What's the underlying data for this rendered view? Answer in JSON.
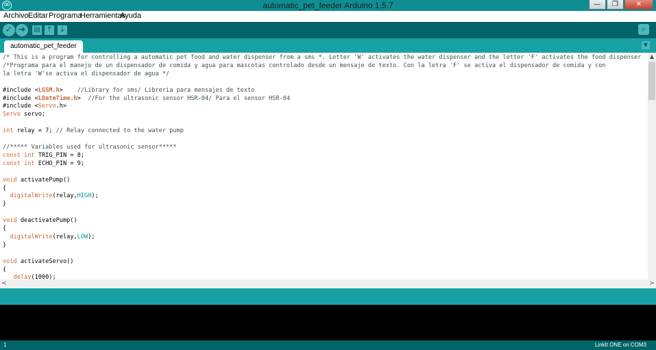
{
  "window": {
    "title": "automatic_pet_feeder Arduino 1.5.7",
    "min_label": "—",
    "max_label": "❐",
    "close_label": "✕"
  },
  "menu": [
    "Archivo",
    "Editar",
    "Programa",
    "Herramientas",
    "Ayuda"
  ],
  "toolbar": {
    "verify_glyph": "✓",
    "upload_glyph": "➜",
    "new_glyph": "▤",
    "open_glyph": "⇡",
    "save_glyph": "⇣",
    "serial_glyph": "⌕"
  },
  "tab": {
    "label": "automatic_pet_feeder",
    "menu_glyph": "▼"
  },
  "code_lines": [
    [
      {
        "t": "/* This is a program for controlling a automatic pet food and water dispenser from a sms *. Letter 'W' activates the water dispenser and the letter 'F' activates the food dispenser",
        "c": "com"
      }
    ],
    [
      {
        "t": "/*Programa para el manejo de un dispensador de comida y agua para mascotas controlado desde un mensaje de texto. Con la letra 'F' se activa el dispensador de comida y con",
        "c": "com"
      }
    ],
    [
      {
        "t": "la letra 'W'se activa el dispensador de agua */",
        "c": "com"
      }
    ],
    [],
    [
      {
        "t": "#include <",
        "c": ""
      },
      {
        "t": "LGSM.h",
        "c": "lib"
      },
      {
        "t": ">    ",
        "c": ""
      },
      {
        "t": "//Library for sms/ Libreria para mensajes de texto",
        "c": "com"
      }
    ],
    [
      {
        "t": "#include <",
        "c": ""
      },
      {
        "t": "LDateTime.h",
        "c": "lib"
      },
      {
        "t": ">  ",
        "c": ""
      },
      {
        "t": "//For the ultrasonic sensor HSR-04/ Para el sensor HSR-04",
        "c": "com"
      }
    ],
    [
      {
        "t": "#include <",
        "c": ""
      },
      {
        "t": "Servo",
        "c": "kw"
      },
      {
        "t": ".h>",
        "c": ""
      }
    ],
    [
      {
        "t": "Servo",
        "c": "kw"
      },
      {
        "t": " servo;",
        "c": ""
      }
    ],
    [],
    [
      {
        "t": "int",
        "c": "kw"
      },
      {
        "t": " relay = 7; ",
        "c": ""
      },
      {
        "t": "// Relay connected to the water pump",
        "c": "com"
      }
    ],
    [],
    [
      {
        "t": "//***** Variables used for ultrasonic sensor*****",
        "c": "com"
      }
    ],
    [
      {
        "t": "const",
        "c": "kw"
      },
      {
        "t": " ",
        "c": ""
      },
      {
        "t": "int",
        "c": "kw"
      },
      {
        "t": " TRIG_PIN = 8;",
        "c": ""
      }
    ],
    [
      {
        "t": "const",
        "c": "kw"
      },
      {
        "t": " ",
        "c": ""
      },
      {
        "t": "int",
        "c": "kw"
      },
      {
        "t": " ECHO_PIN = 9;",
        "c": ""
      }
    ],
    [],
    [
      {
        "t": "void",
        "c": "kw"
      },
      {
        "t": " activatePump()",
        "c": ""
      }
    ],
    [
      {
        "t": "{",
        "c": ""
      }
    ],
    [
      {
        "t": "  ",
        "c": ""
      },
      {
        "t": "digitalWrite",
        "c": "fn"
      },
      {
        "t": "(relay,",
        "c": ""
      },
      {
        "t": "HIGH",
        "c": "const"
      },
      {
        "t": ");",
        "c": ""
      }
    ],
    [
      {
        "t": "}",
        "c": ""
      }
    ],
    [],
    [
      {
        "t": "void",
        "c": "kw"
      },
      {
        "t": " deactivatePump()",
        "c": ""
      }
    ],
    [
      {
        "t": "{",
        "c": ""
      }
    ],
    [
      {
        "t": "  ",
        "c": ""
      },
      {
        "t": "digitalWrite",
        "c": "fn"
      },
      {
        "t": "(relay,",
        "c": ""
      },
      {
        "t": "LOW",
        "c": "const"
      },
      {
        "t": ");",
        "c": ""
      }
    ],
    [
      {
        "t": "}",
        "c": ""
      }
    ],
    [],
    [
      {
        "t": "void",
        "c": "kw"
      },
      {
        "t": " activateServo()",
        "c": ""
      }
    ],
    [
      {
        "t": "{",
        "c": ""
      }
    ],
    [
      {
        "t": "   ",
        "c": ""
      },
      {
        "t": "delay",
        "c": "fn"
      },
      {
        "t": "(1000);",
        "c": ""
      }
    ]
  ],
  "scroll": {
    "up_glyph": "▲",
    "down_glyph": "▼",
    "left_glyph": "<",
    "right_glyph": ">"
  },
  "status": {
    "line_number": "1",
    "board": "LinkIt ONE on COM3"
  },
  "colors": {
    "teal_dark": "#006468",
    "teal_mid": "#17a1a5",
    "keyword": "#cc6633",
    "comment": "#434f54",
    "constant": "#00979c"
  }
}
